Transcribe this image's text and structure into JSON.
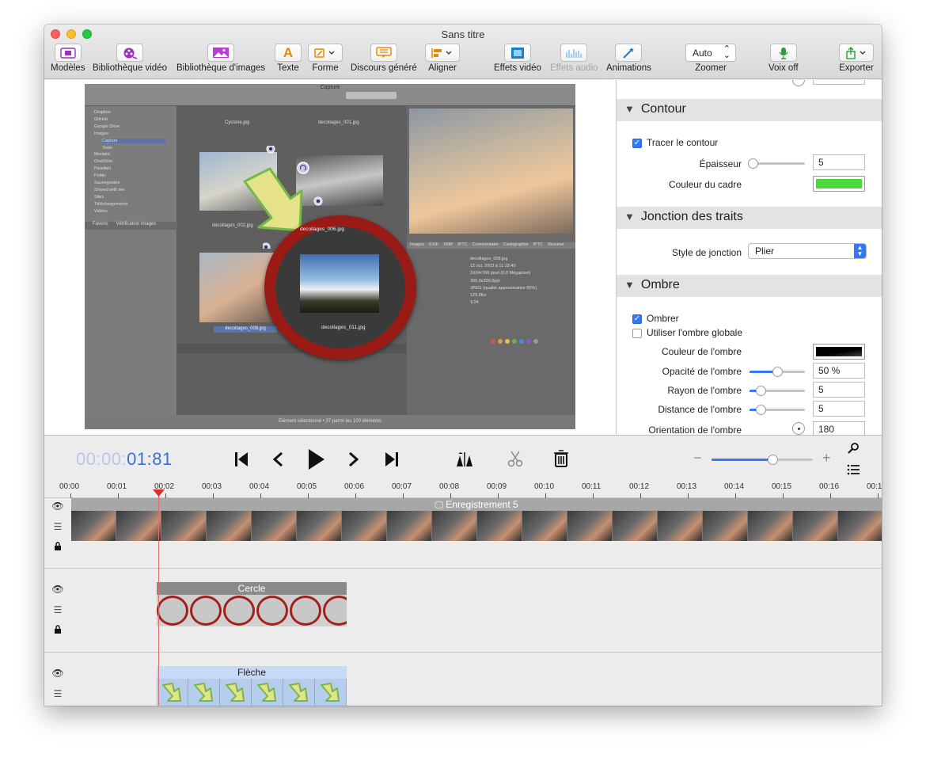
{
  "window": {
    "title": "Sans titre"
  },
  "toolbar": {
    "models": "Modèles",
    "video_library": "Bibliothèque vidéo",
    "image_library": "Bibliothèque d'images",
    "text": "Texte",
    "shape": "Forme",
    "generated_speech": "Discours généré",
    "align": "Aligner",
    "video_effects": "Effets vidéo",
    "audio_effects": "Effets audio",
    "animations": "Animations",
    "zoom_value": "Auto",
    "zoom": "Zoomer",
    "voice_off": "Voix off",
    "export": "Exporter"
  },
  "panel": {
    "contour": {
      "title": "Contour",
      "draw_label": "Tracer le contour",
      "draw_checked": true,
      "thickness_label": "Épaisseur",
      "thickness_value": "5",
      "thickness_level": 0.05,
      "frame_color_label": "Couleur du cadre",
      "frame_color": "#4ed93a"
    },
    "join": {
      "title": "Jonction des traits",
      "style_label": "Style de jonction",
      "style_value": "Plier"
    },
    "shadow": {
      "title": "Ombre",
      "enable_label": "Ombrer",
      "enable_checked": true,
      "global_label": "Utiliser l'ombre globale",
      "global_checked": false,
      "color_label": "Couleur de l'ombre",
      "opacity_label": "Opacité de l'ombre",
      "opacity_value": "50 %",
      "opacity_level": 0.5,
      "radius_label": "Rayon de l'ombre",
      "radius_value": "5",
      "radius_level": 0.2,
      "distance_label": "Distance de l'ombre",
      "distance_value": "5",
      "distance_level": 0.2,
      "orientation_label": "Orientation de l'ombre",
      "orientation_value": "180"
    }
  },
  "transport": {
    "time_dim": "00:00:",
    "time_main": "01:81",
    "zoom_level": 0.6
  },
  "ruler": {
    "ticks": [
      "00:00",
      "00:01",
      "00:02",
      "00:03",
      "00:04",
      "00:05",
      "00:06",
      "00:07",
      "00:08",
      "00:09",
      "00:10",
      "00:11",
      "00:12",
      "00:13",
      "00:14",
      "00:15",
      "00:16",
      "00:1"
    ]
  },
  "tracks": {
    "recording": {
      "label": "Enregistrement 5"
    },
    "circle": {
      "label": "Cercle"
    },
    "arrow": {
      "label": "Flèche"
    }
  },
  "canvas": {
    "finder": {
      "window_title": "Capture",
      "files": [
        "Cyclone.jpg",
        "decollages_001.jpg",
        "decollages_002.jpg",
        "decollages_006.jpg",
        "decollages_008.jpg",
        "decollages_011.jpg"
      ],
      "sidebar": [
        "Dropbox",
        "GitHub",
        "Google Drive",
        "Images",
        "Capture",
        "Tests",
        "Montant",
        "OneDrive",
        "Parallels",
        "Public",
        "Sauvegardes",
        "Shared with me",
        "Sites",
        "Téléchargements",
        "Vidéos"
      ],
      "info_tabs": [
        "Images",
        "EXIF",
        "XMP",
        "IPTC",
        "Commentaire",
        "Cartographie",
        "IPTC",
        "Résumé"
      ],
      "info_rows": [
        "decollages_008.jpg",
        "12 oct. 2003 à 11:18:40",
        "1024x768 pixel (0,8 Mégapixel)",
        "300,0x300,0ppi",
        "JPEG (qualité approximative 85%)",
        "129,0Ko",
        "1/24"
      ],
      "status": "Élément sélectionné • 37 parmi les 100 éléments"
    }
  }
}
